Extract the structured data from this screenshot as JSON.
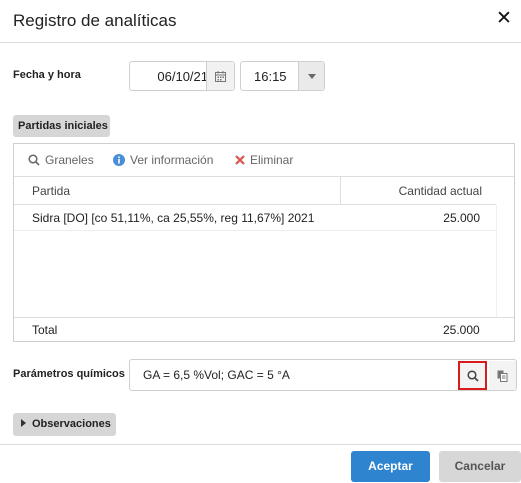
{
  "dialog": {
    "title": "Registro de analíticas",
    "close_icon": "close-icon"
  },
  "datetime": {
    "label": "Fecha y hora",
    "date": "06/10/21",
    "date_icon": "calendar-icon",
    "time": "16:15",
    "time_icon": "chevron-down-icon"
  },
  "partidas": {
    "section_label": "Partidas iniciales",
    "toolbar": [
      {
        "label": "Graneles",
        "icon": "search-icon"
      },
      {
        "label": "Ver información",
        "icon": "info-icon",
        "color": "#4a8fd6"
      },
      {
        "label": "Eliminar",
        "icon": "close-icon",
        "color": "#d9534f"
      }
    ],
    "columns": [
      "Partida",
      "Cantidad actual"
    ],
    "rows": [
      {
        "partida": "Sidra [DO] [co 51,11%, ca 25,55%, reg 11,67%] 2021",
        "cantidad": "25.000"
      }
    ],
    "footer": {
      "label": "Total",
      "value": "25.000"
    }
  },
  "chemical": {
    "label": "Parámetros químicos",
    "value": "GA = 6,5 %Vol; GAC = 5 °A",
    "search_icon": "search-icon",
    "copy_icon": "copy-icon"
  },
  "observaciones": {
    "label": "Observaciones",
    "icon": "caret-right-icon"
  },
  "footer_buttons": {
    "accept": "Aceptar",
    "cancel": "Cancelar"
  },
  "colors": {
    "accent": "#2f84cf",
    "highlight": "#d81c1c"
  }
}
